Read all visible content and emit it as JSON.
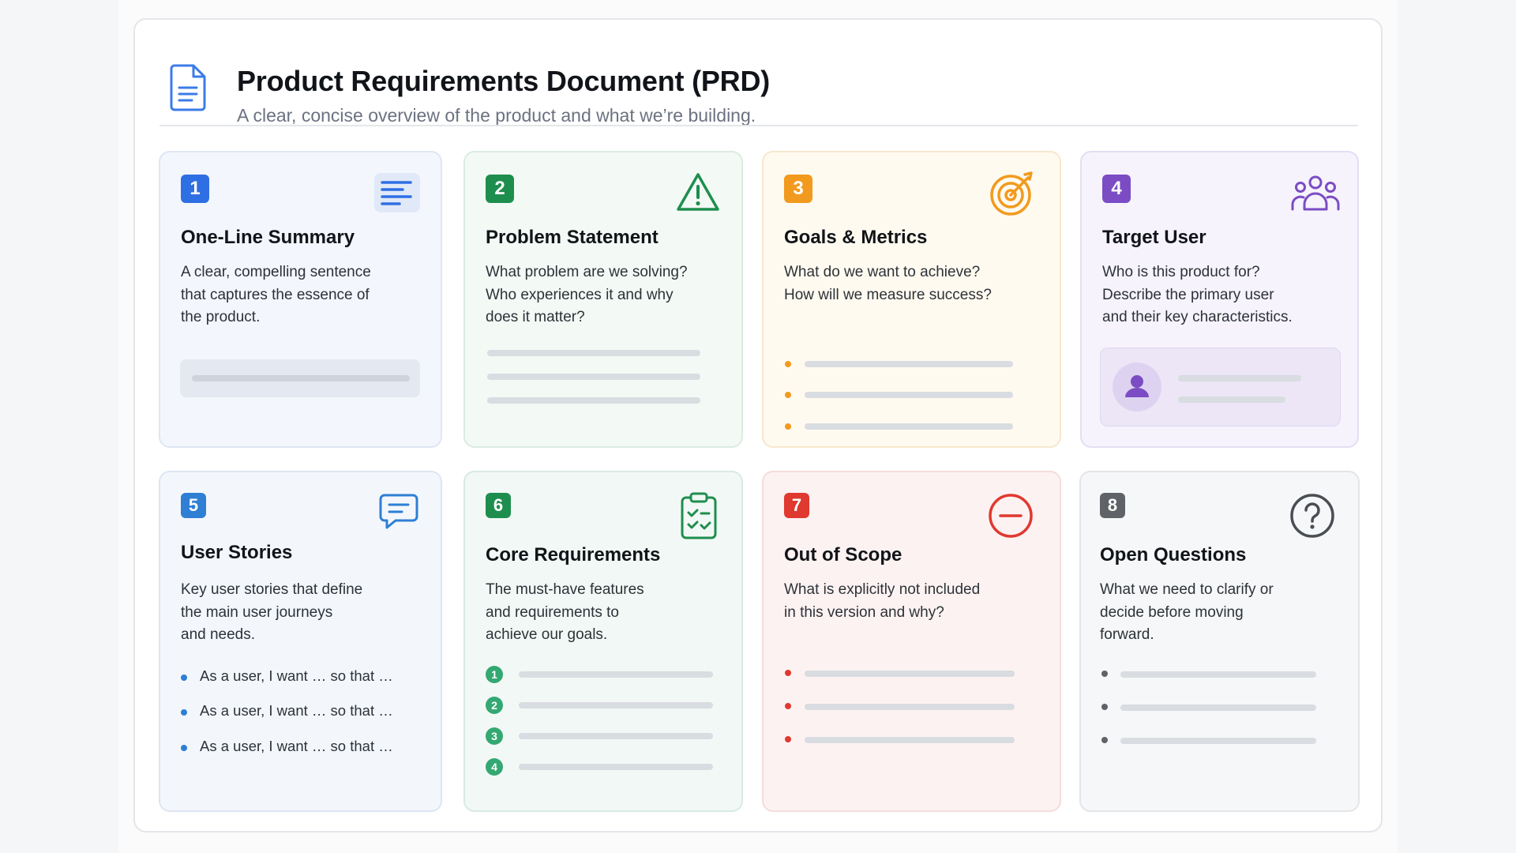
{
  "header": {
    "title": "Product Requirements Document (PRD)",
    "subtitle": "A clear, concise overview of the product and what we’re building.",
    "icon": "document-icon"
  },
  "cards": [
    {
      "number": "1",
      "title": "One-Line Summary",
      "description": "A clear, compelling sentence\nthat captures the essence of\nthe product.",
      "icon": "text-lines-icon",
      "accent": "#2f6fe4"
    },
    {
      "number": "2",
      "title": "Problem Statement",
      "description": "What problem are we solving?\nWho experiences it and why\ndoes it matter?",
      "icon": "warning-icon",
      "accent": "#1e8e4e"
    },
    {
      "number": "3",
      "title": "Goals & Metrics",
      "description": "What do we want to achieve?\nHow will we measure success?",
      "icon": "target-icon",
      "accent": "#f29a1d"
    },
    {
      "number": "4",
      "title": "Target User",
      "description": "Who is this product for?\nDescribe the primary user\nand their key characteristics.",
      "icon": "users-icon",
      "accent": "#7b4cc4"
    },
    {
      "number": "5",
      "title": "User Stories",
      "description": "Key user stories that define\nthe main user journeys\nand needs.",
      "icon": "chat-icon",
      "accent": "#2f7fd4",
      "stories": [
        "As a user, I want … so that …",
        "As a user, I want … so that …",
        "As a user, I want … so that …"
      ]
    },
    {
      "number": "6",
      "title": "Core Requirements",
      "description": "The must-have features\nand requirements to\nachieve our goals.",
      "icon": "clipboard-check-icon",
      "accent": "#1e8e4e",
      "steps": [
        "1",
        "2",
        "3",
        "4"
      ]
    },
    {
      "number": "7",
      "title": "Out of Scope",
      "description": "What is explicitly not included\nin this version and why?",
      "icon": "minus-circle-icon",
      "accent": "#e0392f"
    },
    {
      "number": "8",
      "title": "Open Questions",
      "description": "What we need to clarify or\ndecide before moving\nforward.",
      "icon": "question-circle-icon",
      "accent": "#5f6368"
    }
  ]
}
